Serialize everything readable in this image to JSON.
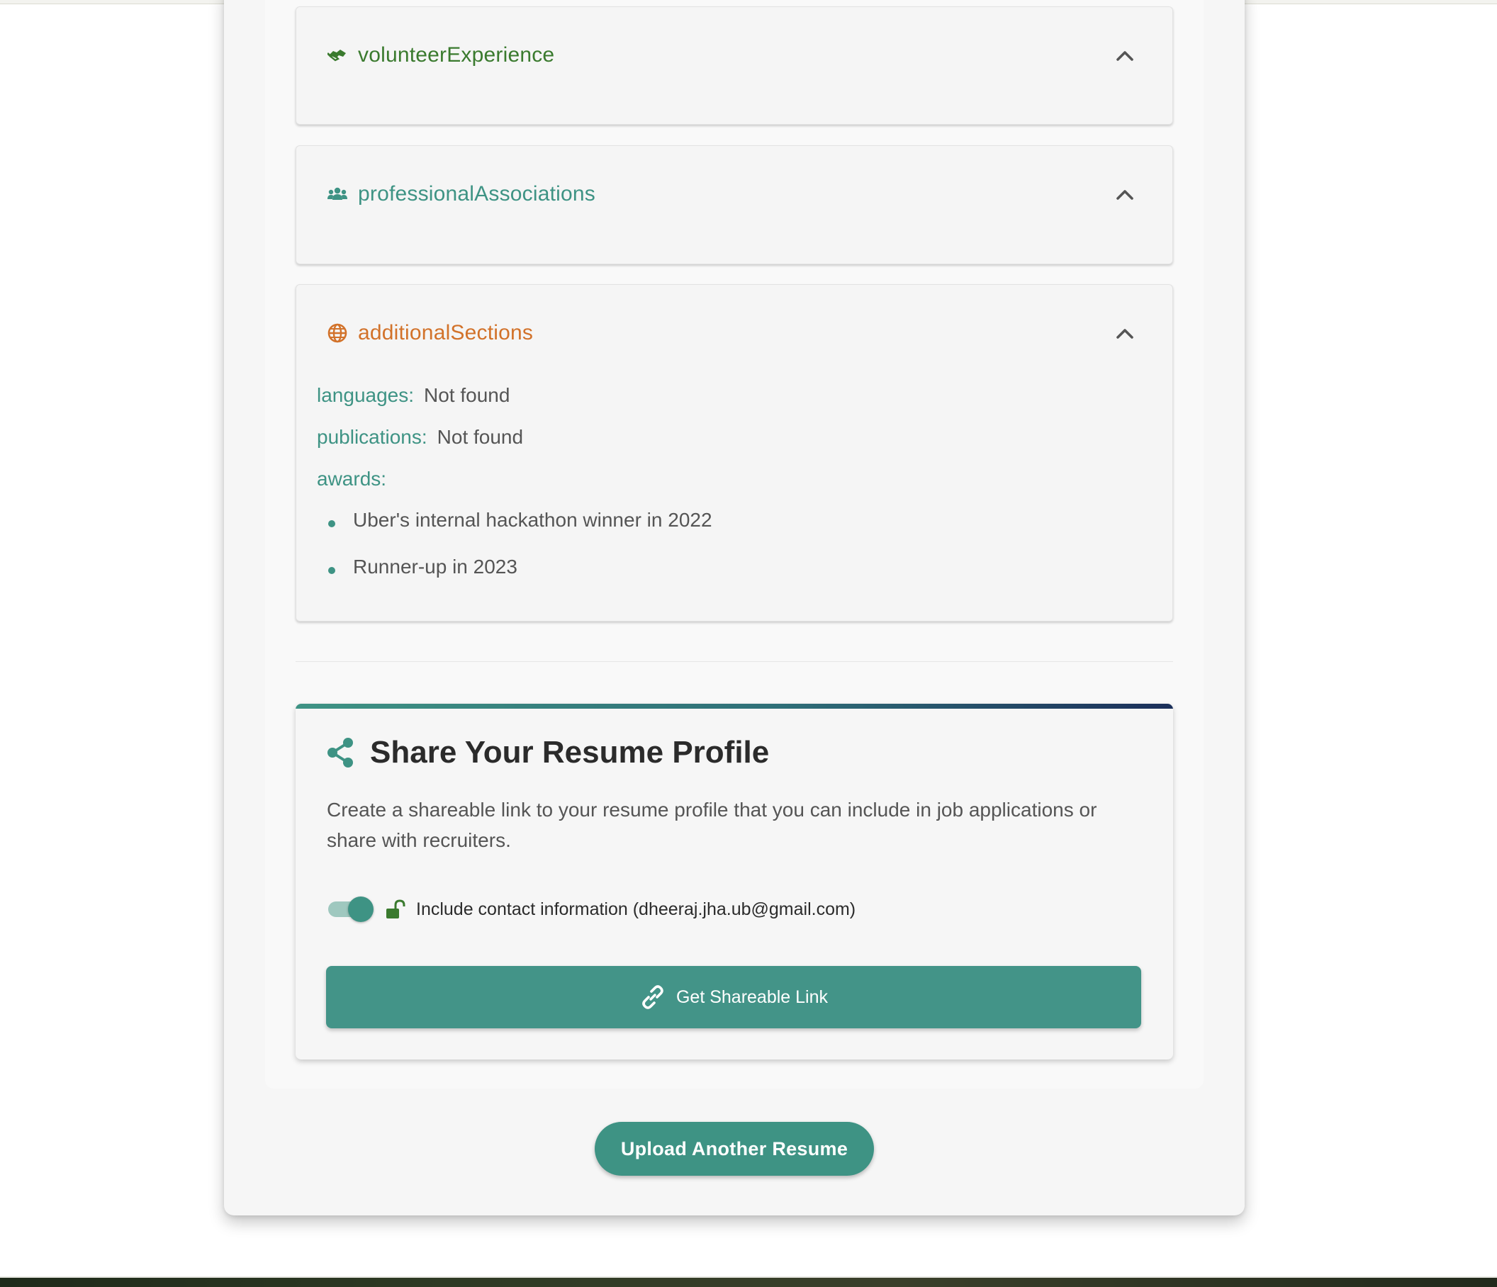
{
  "sections": {
    "volunteer": {
      "title": "volunteerExperience",
      "icon": "handshake-icon",
      "color": "#3a7a2e"
    },
    "associations": {
      "title": "professionalAssociations",
      "icon": "users-icon",
      "color": "#3e9384"
    },
    "additional": {
      "title": "additionalSections",
      "icon": "globe-icon",
      "color": "#d2722a",
      "fields": {
        "languages": {
          "label": "languages:",
          "value": "Not found"
        },
        "publications": {
          "label": "publications:",
          "value": "Not found"
        },
        "awards": {
          "label": "awards:",
          "items": [
            "Uber's internal hackathon winner in 2022",
            "Runner-up in 2023"
          ]
        }
      }
    }
  },
  "share": {
    "title": "Share Your Resume Profile",
    "description": "Create a shareable link to your resume profile that you can include in job applications or share with recruiters.",
    "toggle_label": "Include contact information (dheeraj.jha.ub@gmail.com)",
    "toggle_on": true,
    "button_label": "Get Shareable Link",
    "accent": "#439488"
  },
  "upload_button_label": "Upload Another Resume"
}
